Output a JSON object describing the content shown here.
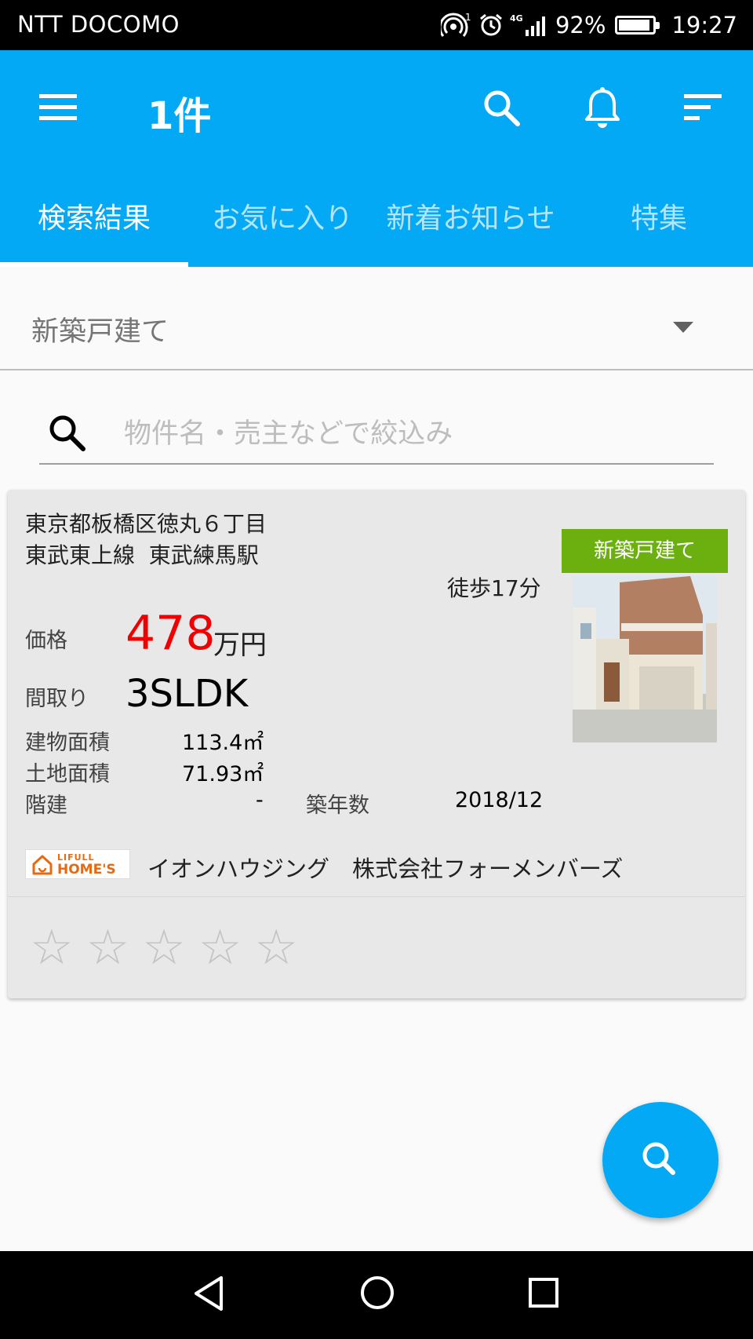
{
  "status_bar": {
    "carrier": "NTT DOCOMO",
    "network": "4G",
    "battery": "92%",
    "battery_level": 0.92,
    "time": "19:27"
  },
  "app_bar": {
    "title": "1件",
    "icons": [
      "menu-icon",
      "search-icon",
      "bell-icon",
      "sort-icon"
    ]
  },
  "tabs": [
    {
      "label": "検索結果",
      "active": true
    },
    {
      "label": "お気に入り",
      "active": false
    },
    {
      "label": "新着お知らせ",
      "active": false
    },
    {
      "label": "特集",
      "active": false
    }
  ],
  "category_dropdown": {
    "value": "新築戸建て"
  },
  "filter": {
    "placeholder": "物件名・売主などで絞込み",
    "value": ""
  },
  "listing": {
    "address": "東京都板橋区徳丸６丁目",
    "line_station": "東武東上線  東武練馬駅",
    "walk": "徒歩17分",
    "badge": "新築戸建て",
    "price_label": "価格",
    "price_value": "478",
    "price_unit": "万円",
    "layout_label": "間取り",
    "layout_value": "3SLDK",
    "building_area_label": "建物面積",
    "building_area_value": "113.4㎡",
    "land_area_label": "土地面積",
    "land_area_value": "71.93㎡",
    "floors_label": "階建",
    "floors_value": "-",
    "built_label": "築年数",
    "built_value": "2018/12",
    "source_logo": {
      "line1": "LIFULL",
      "line2": "HOME'S"
    },
    "company": "イオンハウジング　株式会社フォーメンバーズ",
    "rating": 0,
    "rating_max": 5
  },
  "colors": {
    "primary": "#03a9f4",
    "badge_green": "#6cb010",
    "price_red": "#f00000",
    "logo_orange": "#e86a10"
  }
}
